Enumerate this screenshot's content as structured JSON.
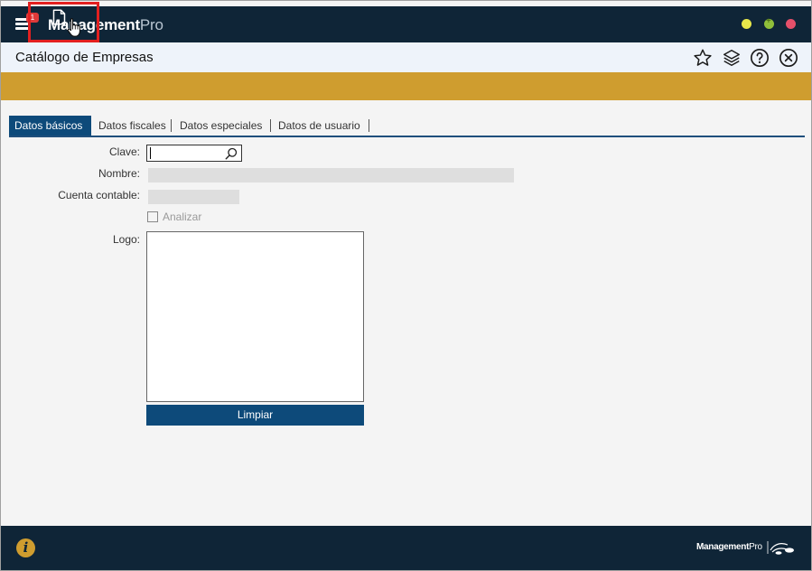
{
  "app": {
    "brand_main": "Management",
    "brand_pro": "Pro",
    "menu_badge": "1"
  },
  "header": {
    "title": "Catálogo de Empresas"
  },
  "tabs": [
    {
      "label": "Datos básicos",
      "active": true
    },
    {
      "label": "Datos fiscales",
      "active": false
    },
    {
      "label": "Datos especiales",
      "active": false
    },
    {
      "label": "Datos de usuario",
      "active": false
    }
  ],
  "form": {
    "clave_label": "Clave:",
    "clave_value": "",
    "nombre_label": "Nombre:",
    "cuenta_label": "Cuenta contable:",
    "analizar_label": "Analizar",
    "analizar_checked": false,
    "logo_label": "Logo:",
    "limpiar_label": "Limpiar"
  },
  "footer": {
    "info_glyph": "i",
    "brand_main": "Management",
    "brand_pro": "Pro"
  },
  "icons": {
    "menu": "hamburger-menu-icon",
    "favorite": "star-icon",
    "layers": "layers-icon",
    "help": "question-circle-icon",
    "close": "close-circle-icon",
    "new_document": "document-icon",
    "cursor": "hand-pointer-icon",
    "search": "search-icon",
    "info": "info-icon"
  },
  "colors": {
    "titlebar": "#0f2537",
    "toolbar": "#cf9d2f",
    "accent": "#0d4a7a",
    "highlight": "#e32020"
  }
}
